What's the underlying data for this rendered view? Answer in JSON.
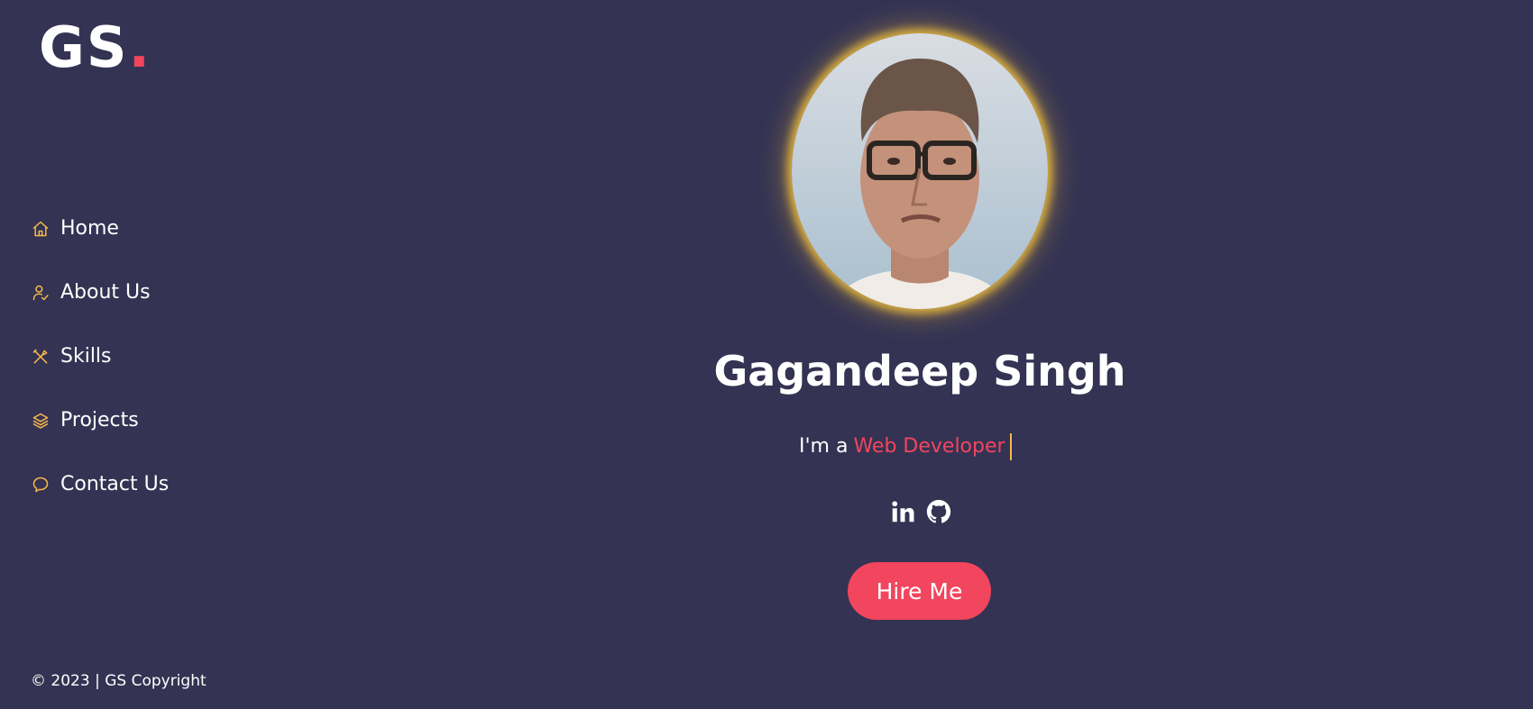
{
  "brand": {
    "logo_text": "GS",
    "logo_dot": ".",
    "accent_color": "#f2455e",
    "icon_color": "#f5b84a",
    "background_color": "#343353"
  },
  "sidebar": {
    "items": [
      {
        "label": "Home",
        "icon": "home-icon"
      },
      {
        "label": "About Us",
        "icon": "user-check-icon"
      },
      {
        "label": "Skills",
        "icon": "tools-icon"
      },
      {
        "label": "Projects",
        "icon": "layers-icon"
      },
      {
        "label": "Contact Us",
        "icon": "chat-bubble-icon"
      }
    ]
  },
  "hero": {
    "name": "Gagandeep Singh",
    "tagline_prefix": "I'm a",
    "tagline_role": "Web Developer",
    "socials": [
      {
        "icon": "linkedin-icon"
      },
      {
        "icon": "github-icon"
      }
    ],
    "cta_label": "Hire Me"
  },
  "footer": {
    "copyright": "© 2023 | GS Copyright"
  }
}
